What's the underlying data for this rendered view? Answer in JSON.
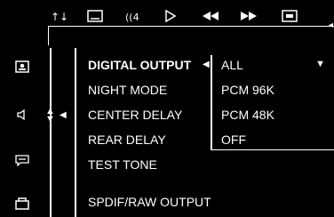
{
  "toolbar": {
    "icons": [
      "audio-settings-icon",
      "subtitle-icon",
      "audio-icon",
      "play-icon",
      "rewind-icon",
      "fast-forward-icon",
      "display-icon"
    ]
  },
  "sidebar": {
    "icons": [
      "user-icon",
      "speaker-icon",
      "message-icon",
      "lock-icon"
    ]
  },
  "menu": {
    "items": [
      "DIGITAL OUTPUT",
      "NIGHT MODE",
      "CENTER DELAY",
      "REAR DELAY",
      "TEST TONE",
      "SPDIF/RAW OUTPUT"
    ]
  },
  "dropdown": {
    "selected": "ALL",
    "options": [
      "PCM 96K",
      "PCM 48K",
      "OFF"
    ]
  }
}
